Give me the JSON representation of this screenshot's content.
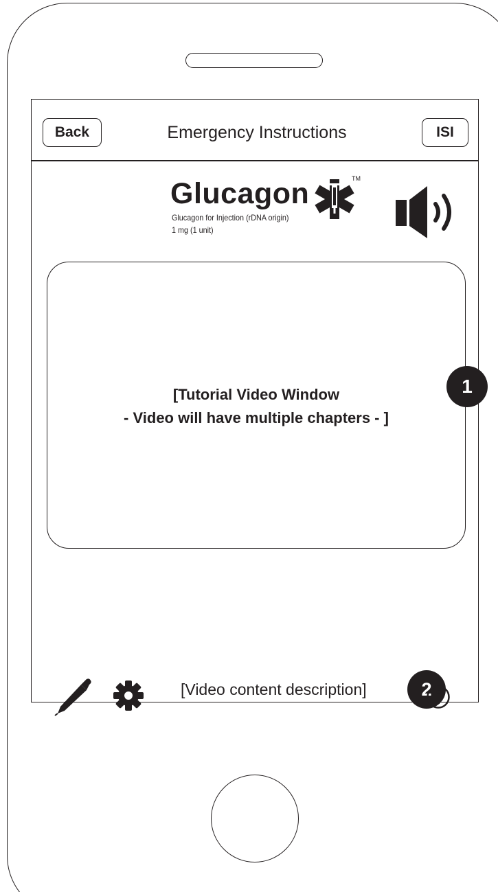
{
  "nav": {
    "back_label": "Back",
    "title": "Emergency Instructions",
    "isi_label": "ISI"
  },
  "brand": {
    "name": "Glucagon",
    "trademark": "TM",
    "subtitle_line1": "Glucagon for Injection (rDNA origin)",
    "subtitle_line2": "1 mg (1 unit)",
    "logo_icon": "star-of-life-syringe-icon"
  },
  "audio": {
    "icon": "speaker-volume-icon"
  },
  "video": {
    "line1": "[Tutorial Video Window",
    "line2": "- Video will have multiple chapters - ]"
  },
  "annotations": {
    "badge_1": "1",
    "badge_2": "2"
  },
  "description": "[Video content description]",
  "toolbar": {
    "icons": [
      "pen-icon",
      "gear-icon",
      "info-icon"
    ]
  },
  "colors": {
    "ink": "#231f20",
    "background": "#ffffff"
  }
}
